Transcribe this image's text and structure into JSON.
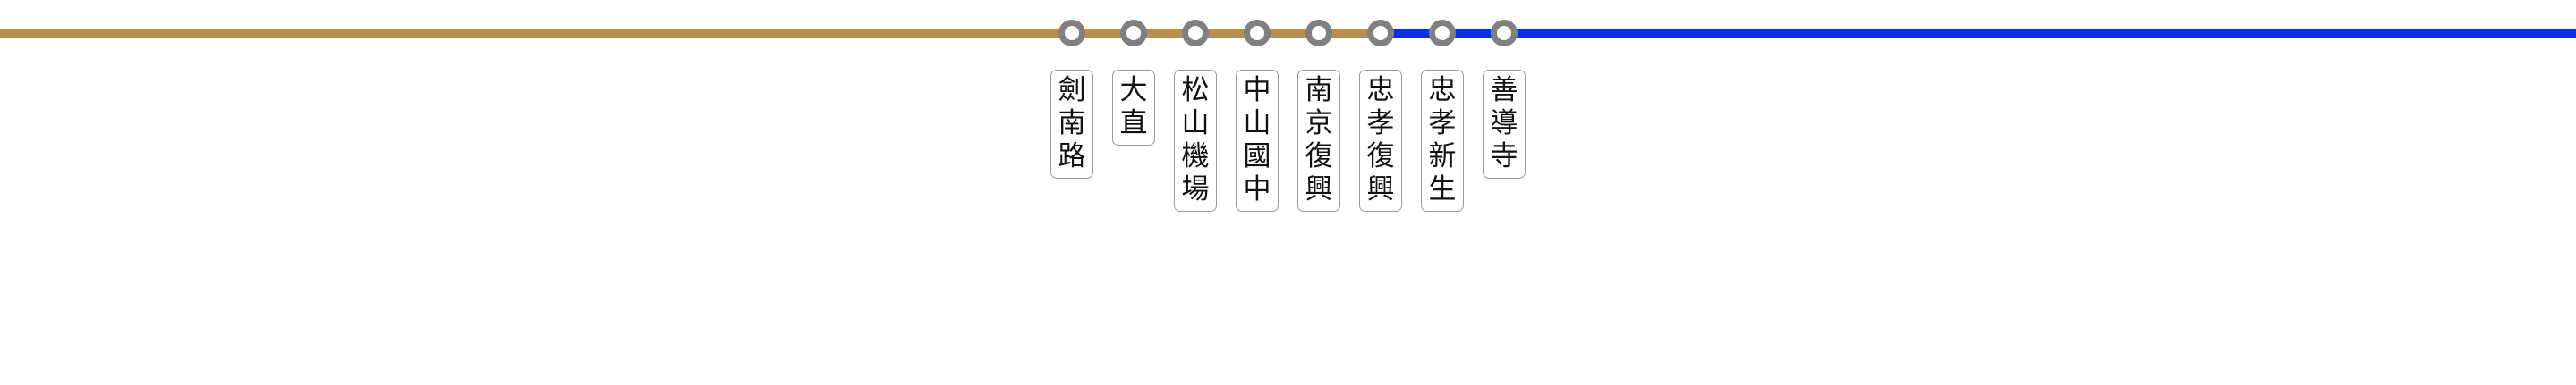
{
  "line_colors": {
    "brown_line": "#b88f4c",
    "blue_line": "#0a2fe8",
    "station_ring": "#808080",
    "station_fill": "#ffffff"
  },
  "line_segments": [
    {
      "color": "brown_line",
      "from": "west-edge",
      "to": "忠孝復興"
    },
    {
      "color": "blue_line",
      "from": "忠孝復興",
      "to": "east-edge"
    }
  ],
  "stations": [
    {
      "name": "劍南路",
      "chars": [
        "劍",
        "南",
        "路"
      ]
    },
    {
      "name": "大直",
      "chars": [
        "大",
        "直"
      ]
    },
    {
      "name": "松山機場",
      "chars": [
        "松",
        "山",
        "機",
        "場"
      ]
    },
    {
      "name": "中山國中",
      "chars": [
        "中",
        "山",
        "國",
        "中"
      ]
    },
    {
      "name": "南京復興",
      "chars": [
        "南",
        "京",
        "復",
        "興"
      ]
    },
    {
      "name": "忠孝復興",
      "chars": [
        "忠",
        "孝",
        "復",
        "興"
      ]
    },
    {
      "name": "忠孝新生",
      "chars": [
        "忠",
        "孝",
        "新",
        "生"
      ]
    },
    {
      "name": "善導寺",
      "chars": [
        "善",
        "導",
        "寺"
      ]
    }
  ]
}
